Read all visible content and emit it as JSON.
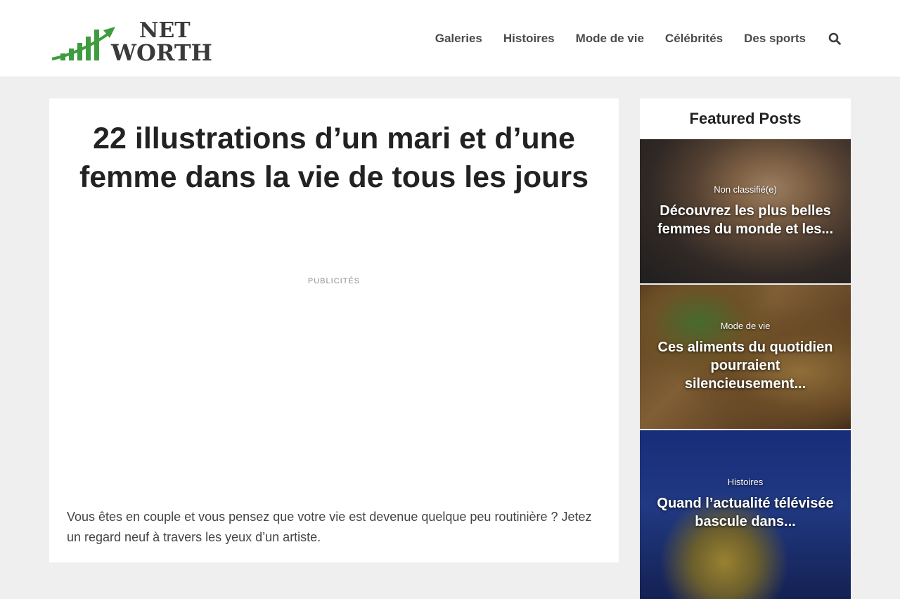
{
  "header": {
    "logo": {
      "line1": "NET",
      "line2": "WORTH",
      "accent_color": "#3e9c3e",
      "text_color": "#3a3a3a"
    },
    "nav": [
      {
        "label": "Galeries"
      },
      {
        "label": "Histoires"
      },
      {
        "label": "Mode de vie"
      },
      {
        "label": "Célébrités"
      },
      {
        "label": "Des sports"
      }
    ],
    "search_icon": "search-icon"
  },
  "article": {
    "title": "22 illustrations d’un mari et d’une femme dans la vie de tous les jours",
    "ad_label": "PUBLICITÉS",
    "intro": "Vous êtes en couple et vous pensez que votre vie est devenue quelque peu routinière ? Jetez un regard neuf à travers les yeux d’un artiste."
  },
  "sidebar": {
    "title": "Featured Posts",
    "posts": [
      {
        "category": "Non classifié(e)",
        "title": "Découvrez les plus belles femmes du monde et les..."
      },
      {
        "category": "Mode de vie",
        "title": "Ces aliments du quotidien pourraient silencieusement..."
      },
      {
        "category": "Histoires",
        "title": "Quand l’actualité télévisée bascule dans..."
      }
    ]
  }
}
